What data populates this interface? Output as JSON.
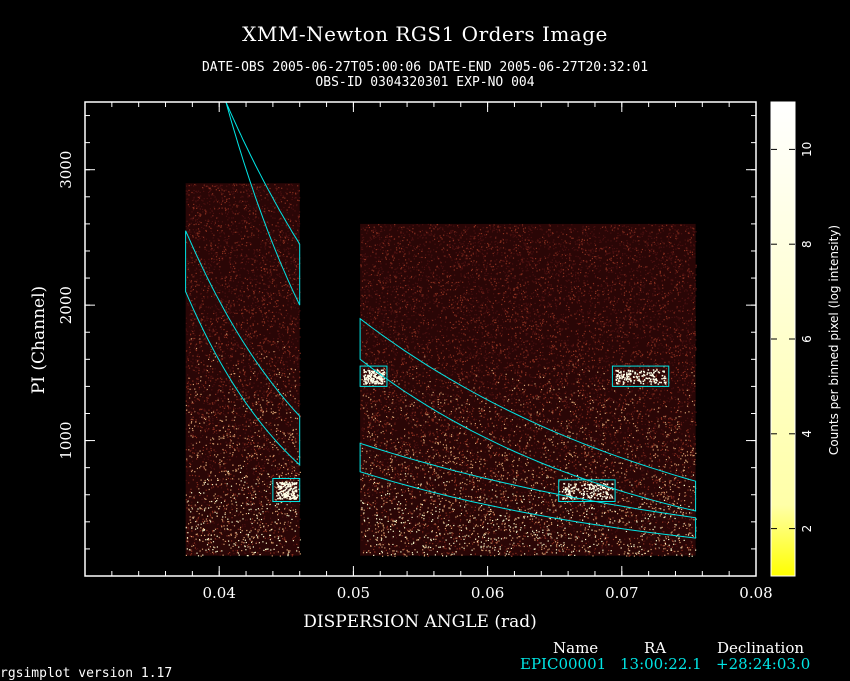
{
  "header": {
    "title": "XMM-Newton  RGS1 Orders Image",
    "line1": "DATE-OBS 2005-06-27T05:00:06   DATE-END 2005-06-27T20:32:01",
    "line2": "OBS-ID 0304320301 EXP-NO 004"
  },
  "chart_data": {
    "type": "heatmap",
    "xlabel": "DISPERSION ANGLE (rad)",
    "ylabel": "PI (Channel)",
    "xlim": [
      0.03,
      0.08
    ],
    "ylim": [
      0,
      3500
    ],
    "xticks": [
      0.04,
      0.05,
      0.06,
      0.07,
      0.08
    ],
    "xtick_labels": [
      "0.04",
      "0.05",
      "0.06",
      "0.07",
      "0.08"
    ],
    "yticks": [
      1000,
      2000,
      3000
    ],
    "ytick_labels": [
      "1000",
      "2000",
      "3000"
    ],
    "colorbar": {
      "label": "Counts per binned pixel (log intensity)",
      "range": [
        1,
        11
      ],
      "ticks": [
        2,
        4,
        6,
        8,
        10
      ],
      "tick_labels": [
        "2",
        "4",
        "6",
        "8",
        "10"
      ],
      "colors": [
        "#ffff00",
        "#ffffff"
      ]
    },
    "detector_regions": [
      {
        "x0": 0.0375,
        "x1": 0.046,
        "ymin": 150,
        "ymax": 2900
      },
      {
        "x0": 0.0505,
        "x1": 0.0755,
        "ymin": 150,
        "ymax": 2600
      }
    ],
    "source_boxes": [
      {
        "x0": 0.044,
        "x1": 0.046,
        "y0": 550,
        "y1": 720
      },
      {
        "x0": 0.0505,
        "x1": 0.0525,
        "y0": 1400,
        "y1": 1550
      },
      {
        "x0": 0.0653,
        "x1": 0.0695,
        "y0": 550,
        "y1": 710
      },
      {
        "x0": 0.0693,
        "x1": 0.0735,
        "y0": 1400,
        "y1": 1550
      }
    ],
    "extraction_regions": [
      {
        "x0": 0.0375,
        "x1": 0.046,
        "top": [
          2550,
          1180
        ],
        "bottom": [
          2100,
          820
        ]
      },
      {
        "x0": 0.0505,
        "x1": 0.0755,
        "top": [
          1900,
          700
        ],
        "bottom": [
          1600,
          480
        ]
      },
      {
        "x0": 0.0505,
        "x1": 0.0755,
        "top": [
          980,
          430
        ],
        "bottom": [
          770,
          280
        ]
      },
      {
        "x0": 0.0405,
        "x1": 0.046,
        "top": [
          3500,
          2450
        ],
        "bottom": [
          3500,
          2000
        ]
      }
    ],
    "grid": false,
    "legend": "colorbar-right"
  },
  "footer": {
    "col_name": "Name",
    "col_ra": "RA",
    "col_dec": "Declination",
    "name": "EPIC00001",
    "ra": "13:00:22.1",
    "dec": "+28:24:03.0",
    "version": "rgsimplot version 1.17",
    "accent_color": "#00e5e5"
  }
}
